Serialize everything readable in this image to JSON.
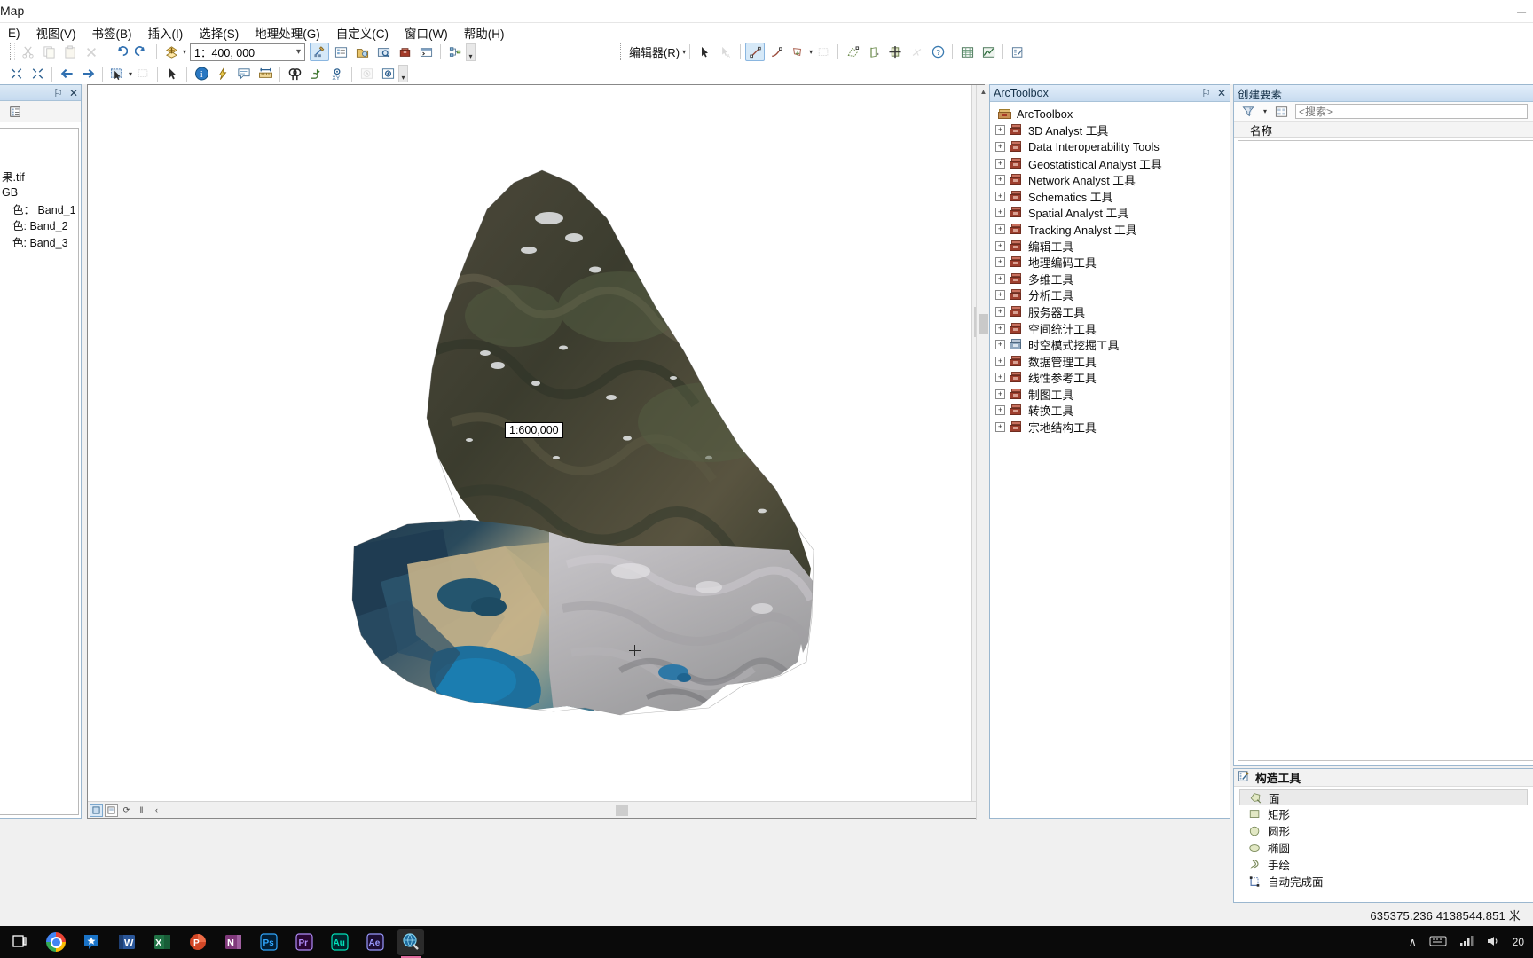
{
  "window": {
    "title": "Map",
    "minimize": "─",
    "maximize": "❐",
    "close": "✕"
  },
  "menubar": [
    {
      "label": "E)"
    },
    {
      "label": "视图(V)"
    },
    {
      "label": "书签(B)"
    },
    {
      "label": "插入(I)"
    },
    {
      "label": "选择(S)"
    },
    {
      "label": "地理处理(G)"
    },
    {
      "label": "自定义(C)"
    },
    {
      "label": "窗口(W)"
    },
    {
      "label": "帮助(H)"
    }
  ],
  "toolbar_standard": {
    "scale_value": "1：400, 000",
    "buttons": [
      {
        "name": "cut-button",
        "glyph": "✂"
      },
      {
        "name": "copy-button",
        "glyph": "❐"
      },
      {
        "name": "paste-button",
        "glyph": "▤"
      },
      {
        "name": "delete-button",
        "glyph": "✕"
      },
      {
        "name": "undo-button",
        "glyph": "↶"
      },
      {
        "name": "redo-button",
        "glyph": "↷"
      },
      {
        "name": "add-data-button",
        "glyph": "➕"
      }
    ],
    "right_buttons": [
      {
        "name": "editor-toolbar-button",
        "glyph": "✎"
      },
      {
        "name": "table-of-contents-button",
        "glyph": "☰"
      },
      {
        "name": "catalog-button",
        "glyph": "⛃"
      },
      {
        "name": "search-window-button",
        "glyph": "⌕"
      },
      {
        "name": "arctoolbox-button",
        "glyph": "❖"
      },
      {
        "name": "python-window-button",
        "glyph": "⌫"
      },
      {
        "name": "model-builder-button",
        "glyph": "⬡"
      }
    ]
  },
  "toolbar_tools": {
    "buttons": [
      {
        "name": "zoom-in-button",
        "glyph": "⤢"
      },
      {
        "name": "zoom-out-button",
        "glyph": "⤡"
      },
      {
        "name": "pan-back-button",
        "glyph": "⬅"
      },
      {
        "name": "pan-forward-button",
        "glyph": "➡"
      },
      {
        "name": "full-extent-button",
        "glyph": "⬚"
      },
      {
        "name": "fixed-zoom-button",
        "glyph": "▣"
      },
      {
        "name": "select-features-button",
        "glyph": "➤"
      },
      {
        "name": "identify-button",
        "glyph": "i"
      },
      {
        "name": "hyperlink-button",
        "glyph": "⚡"
      },
      {
        "name": "html-popup-button",
        "glyph": "▧"
      },
      {
        "name": "measure-button",
        "glyph": "↔"
      },
      {
        "name": "find-button",
        "glyph": "⌕"
      },
      {
        "name": "find-route-button",
        "glyph": "↗"
      },
      {
        "name": "go-to-xy-button",
        "glyph": "XY"
      },
      {
        "name": "time-slider-button",
        "glyph": "⏱"
      },
      {
        "name": "create-viewer-window-button",
        "glyph": "⊕"
      }
    ]
  },
  "toolbar_editor": {
    "menu_label": "编辑器(R)",
    "buttons": [
      {
        "name": "edit-tool-button",
        "glyph": "➤"
      },
      {
        "name": "edit-annotation-button",
        "glyph": "➤"
      },
      {
        "name": "straight-segment-button",
        "glyph": "↗"
      },
      {
        "name": "curve-segment-button",
        "glyph": "⤴"
      },
      {
        "name": "create-features-button",
        "glyph": "⬠"
      },
      {
        "name": "edit-vertices-button",
        "glyph": "◫"
      },
      {
        "name": "trace-button",
        "glyph": "◱"
      },
      {
        "name": "split-tool-button",
        "glyph": "⊣"
      },
      {
        "name": "merge-button",
        "glyph": "✚"
      },
      {
        "name": "rotate-button",
        "glyph": "✕"
      },
      {
        "name": "attributes-button",
        "glyph": "?"
      },
      {
        "name": "table-window-button",
        "glyph": "▤"
      },
      {
        "name": "sketch-properties-button",
        "glyph": "◩"
      },
      {
        "name": "editor-options-button",
        "glyph": "✏"
      }
    ]
  },
  "toc": {
    "pin_icon": "⚐",
    "close_icon": "✕",
    "list_by_drawing_order_icon": "☰",
    "rows": [
      {
        "label": "果.tif"
      },
      {
        "label": "GB"
      },
      {
        "label": "色：    Band_1"
      },
      {
        "label": "色: Band_2"
      },
      {
        "label": "色: Band_3"
      }
    ]
  },
  "map": {
    "scale_popup": "1:600,000",
    "nav_buttons": [
      {
        "name": "data-view-button",
        "glyph": "▣"
      },
      {
        "name": "layout-view-button",
        "glyph": "▧"
      },
      {
        "name": "refresh-view-button",
        "glyph": "⟳"
      },
      {
        "name": "pause-drawing-button",
        "glyph": "‖"
      },
      {
        "name": "previous-page-button",
        "glyph": "‹"
      }
    ],
    "scroll_right_glyph": "›",
    "scroll_up_glyph": "▲",
    "scroll_down_glyph": "▼"
  },
  "arctoolbox": {
    "panel_title": "ArcToolbox",
    "pin_icon": "⚐",
    "close_icon": "✕",
    "root": "ArcToolbox",
    "items": [
      {
        "label": "3D Analyst 工具",
        "icon": "red"
      },
      {
        "label": "Data Interoperability Tools",
        "icon": "red"
      },
      {
        "label": "Geostatistical Analyst 工具",
        "icon": "red"
      },
      {
        "label": "Network Analyst 工具",
        "icon": "red"
      },
      {
        "label": "Schematics 工具",
        "icon": "red"
      },
      {
        "label": "Spatial Analyst 工具",
        "icon": "red"
      },
      {
        "label": "Tracking Analyst 工具",
        "icon": "red"
      },
      {
        "label": "编辑工具",
        "icon": "red"
      },
      {
        "label": "地理编码工具",
        "icon": "red"
      },
      {
        "label": "多维工具",
        "icon": "red"
      },
      {
        "label": "分析工具",
        "icon": "red"
      },
      {
        "label": "服务器工具",
        "icon": "red"
      },
      {
        "label": "空间统计工具",
        "icon": "red"
      },
      {
        "label": "时空模式挖掘工具",
        "icon": "blue"
      },
      {
        "label": "数据管理工具",
        "icon": "red"
      },
      {
        "label": "线性参考工具",
        "icon": "red"
      },
      {
        "label": "制图工具",
        "icon": "red"
      },
      {
        "label": "转换工具",
        "icon": "red"
      },
      {
        "label": "宗地结构工具",
        "icon": "red"
      }
    ],
    "expand_glyph": "+"
  },
  "create_features": {
    "panel_title": "创建要素",
    "filter_icon": "☲",
    "search_placeholder": "<搜索>",
    "column_header": "名称",
    "items": [
      {
        "label": "名称"
      }
    ]
  },
  "construction_tools": {
    "panel_title": "构造工具",
    "items": [
      {
        "label": "面",
        "icon": "polygon-icon",
        "selected": true
      },
      {
        "label": "矩形",
        "icon": "rectangle-icon",
        "selected": false
      },
      {
        "label": "圆形",
        "icon": "circle-icon",
        "selected": false
      },
      {
        "label": "椭圆",
        "icon": "ellipse-icon",
        "selected": false
      },
      {
        "label": "手绘",
        "icon": "freehand-icon",
        "selected": false
      },
      {
        "label": "自动完成面",
        "icon": "autocomplete-polygon-icon",
        "selected": false
      }
    ]
  },
  "statusbar": {
    "coordinates": "635375.236  4138544.851 米"
  },
  "taskbar": {
    "apps": [
      {
        "name": "task-view-button",
        "label": "⌸",
        "kind": "taskview"
      },
      {
        "name": "chrome-icon",
        "label": "",
        "kind": "chrome"
      },
      {
        "name": "star-app-icon",
        "label": "✱",
        "kind": "star"
      },
      {
        "name": "word-icon",
        "label": "W",
        "kind": "office",
        "color": "#2b579a"
      },
      {
        "name": "excel-icon",
        "label": "X",
        "kind": "office",
        "color": "#217346"
      },
      {
        "name": "powerpoint-icon",
        "label": "P",
        "kind": "office",
        "color": "#d24726"
      },
      {
        "name": "onenote-icon",
        "label": "N",
        "kind": "office",
        "color": "#80397b"
      },
      {
        "name": "photoshop-icon",
        "label": "Ps",
        "kind": "adobe",
        "color": "#31a8ff"
      },
      {
        "name": "premiere-icon",
        "label": "Pr",
        "kind": "adobe",
        "color": "#b18cf9"
      },
      {
        "name": "audition-icon",
        "label": "Au",
        "kind": "adobe",
        "color": "#00e4bb"
      },
      {
        "name": "aftereffects-icon",
        "label": "Ae",
        "kind": "adobe",
        "color": "#9999ff"
      },
      {
        "name": "arcmap-icon",
        "label": "",
        "kind": "arcmap",
        "active": true
      }
    ],
    "tray": {
      "chevron": "∧",
      "keyboard": "⌨",
      "network": "📶",
      "volume": "🔊",
      "clock": "20"
    }
  }
}
